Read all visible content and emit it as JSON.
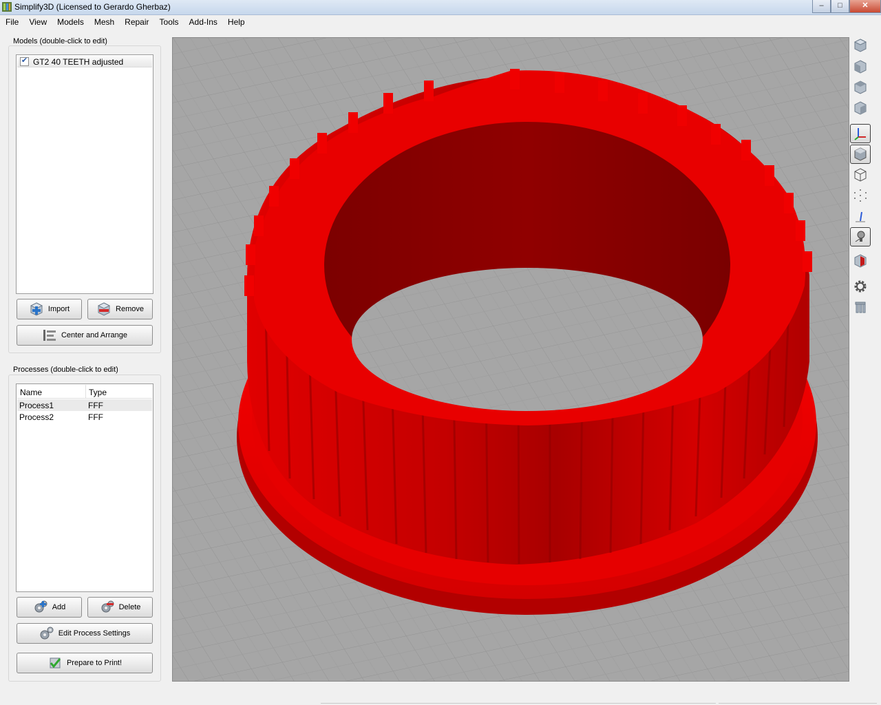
{
  "window": {
    "title": "Simplify3D (Licensed to Gerardo Gherbaz)",
    "controls": {
      "minimize": "–",
      "maximize": "□",
      "close": "✕"
    }
  },
  "menu": [
    "File",
    "View",
    "Models",
    "Mesh",
    "Repair",
    "Tools",
    "Add-Ins",
    "Help"
  ],
  "models_panel": {
    "title": "Models (double-click to edit)",
    "items": [
      {
        "label": "GT2 40 TEETH adjusted",
        "checked": true,
        "check_glyph": "✔"
      }
    ],
    "import_label": "Import",
    "remove_label": "Remove",
    "center_label": "Center and Arrange"
  },
  "processes_panel": {
    "title": "Processes (double-click to edit)",
    "columns": [
      "Name",
      "Type"
    ],
    "rows": [
      {
        "name": "Process1",
        "type": "FFF"
      },
      {
        "name": "Process2",
        "type": "FFF"
      }
    ],
    "add_label": "Add",
    "delete_label": "Delete",
    "edit_label": "Edit Process Settings",
    "prepare_label": "Prepare to Print!"
  },
  "viewport": {
    "model_color": "#e20000",
    "model_shadow": "#8a0000",
    "bed_color": "#a6a6a6",
    "grid_color": "#949494"
  },
  "toolbar_icons": [
    "view-iso-icon",
    "view-front-icon",
    "view-top-icon",
    "view-side-icon",
    "axes-icon",
    "solid-view-icon",
    "wireframe-icon",
    "point-cloud-icon",
    "normals-icon",
    "lighting-icon",
    "cross-section-icon",
    "settings-gear-icon",
    "support-icon"
  ]
}
